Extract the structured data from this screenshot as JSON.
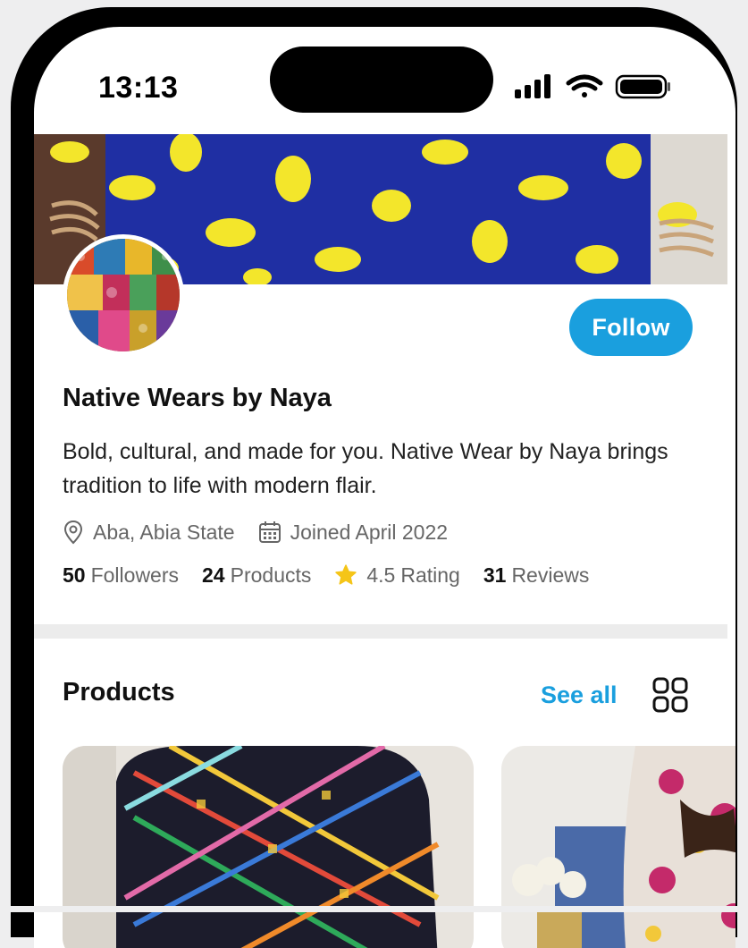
{
  "status_bar": {
    "time": "13:13",
    "icons": [
      "cellular-signal-icon",
      "wifi-icon",
      "battery-icon"
    ]
  },
  "store": {
    "name": "Native Wears by Naya",
    "bio": "Bold, cultural, and made for you. Native Wear by Naya brings tradition to life with modern flair.",
    "location": "Aba, Abia State",
    "joined": "Joined April 2022",
    "follow_label": "Follow"
  },
  "stats": {
    "followers_count": "50",
    "followers_label": "Followers",
    "products_count": "24",
    "products_label": "Products",
    "rating_value": "4.5",
    "rating_label": "Rating",
    "reviews_count": "31",
    "reviews_label": "Reviews"
  },
  "products_section": {
    "title": "Products",
    "see_all_label": "See all"
  },
  "colors": {
    "accent": "#1a9fde",
    "star": "#f5c518",
    "divider": "#ececec"
  }
}
